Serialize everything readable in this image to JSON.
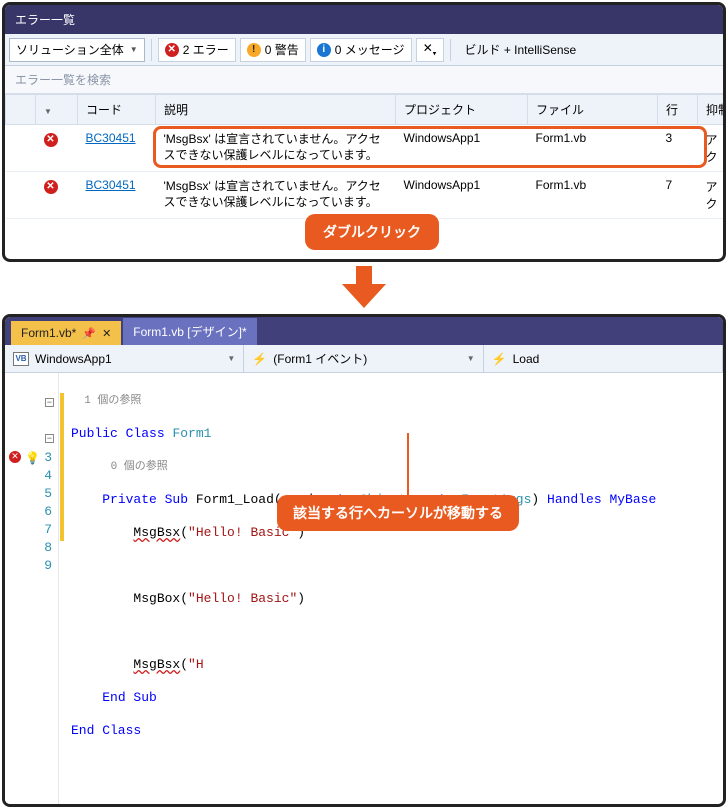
{
  "errorList": {
    "title": "エラー一覧",
    "scopeCombo": "ソリューション全体",
    "errBtn": "2 エラー",
    "warnBtn": "0 警告",
    "msgBtn": "0 メッセージ",
    "buildLabel": "ビルド + IntelliSense",
    "searchPlaceholder": "エラー一覧を検索",
    "cols": {
      "blank": "",
      "code": "コード",
      "desc": "説明",
      "proj": "プロジェクト",
      "file": "ファイル",
      "line": "行",
      "sup": "抑制"
    },
    "rows": [
      {
        "code": "BC30451",
        "desc": "'MsgBsx' は宣言されていません。アクセスできない保護レベルになっています。",
        "proj": "WindowsApp1",
        "file": "Form1.vb",
        "line": "3",
        "sup": "アク"
      },
      {
        "code": "BC30451",
        "desc": "'MsgBsx' は宣言されていません。アクセスできない保護レベルになっています。",
        "proj": "WindowsApp1",
        "file": "Form1.vb",
        "line": "7",
        "sup": "アク"
      }
    ]
  },
  "callout1": "ダブルクリック",
  "callout2": "該当する行へカーソルが移動する",
  "editor": {
    "tabs": [
      {
        "label": "Form1.vb*",
        "active": true,
        "pinned": true
      },
      {
        "label": "Form1.vb [デザイン]*",
        "active": false
      }
    ],
    "crumbs": {
      "proj": "WindowsApp1",
      "event": "(Form1 イベント)",
      "method": "Load"
    },
    "refs1": "1 個の参照",
    "refs0": "0 個の参照",
    "code": {
      "l1a": "Public Class",
      "l1b": "Form1",
      "l2a": "Private Sub",
      "l2b": "Form1_Load",
      "l2c": "sender",
      "l2d": "As",
      "l2e": "Object",
      "l2f": "e",
      "l2g": "As",
      "l2h": "EventArgs",
      "l2i": "Handles",
      "l2j": "MyBase",
      "l3a": "MsgBsx",
      "l3b": "\"Hello! Basic\"",
      "l5a": "MsgBox",
      "l5b": "\"Hello! Basic\"",
      "l7a": "MsgBsx",
      "l7b": "\"H",
      "l8": "End Sub",
      "l9": "End Class"
    }
  }
}
